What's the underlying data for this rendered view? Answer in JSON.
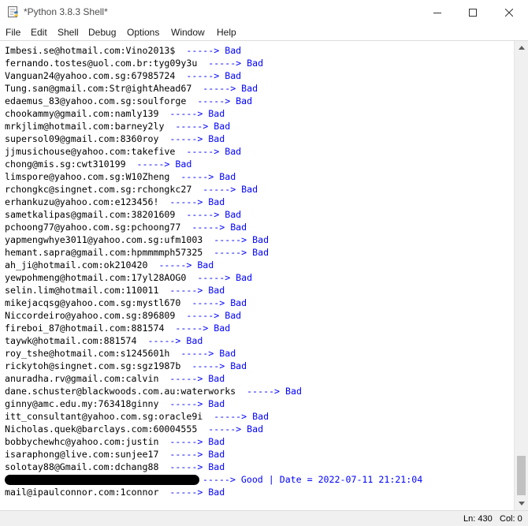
{
  "window": {
    "title": "*Python 3.8.3 Shell*",
    "icon": "python-idle-icon"
  },
  "menu": [
    "File",
    "Edit",
    "Shell",
    "Debug",
    "Options",
    "Window",
    "Help"
  ],
  "colors": {
    "stdout": "#0000ff",
    "text": "#000000",
    "background": "#ffffff"
  },
  "lines": [
    {
      "text": "Imbesi.se@hotmail.com:Vino2013$",
      "result": "-----> Bad"
    },
    {
      "text": "fernando.tostes@uol.com.br:tyg09y3u",
      "result": "-----> Bad"
    },
    {
      "text": "Vanguan24@yahoo.com.sg:67985724",
      "result": "-----> Bad"
    },
    {
      "text": "Tung.san@gmail.com:Str@ightAhead67",
      "result": "-----> Bad"
    },
    {
      "text": "edaemus_83@yahoo.com.sg:soulforge",
      "result": "-----> Bad"
    },
    {
      "text": "chookammy@gmail.com:namly139",
      "result": "-----> Bad"
    },
    {
      "text": "mrkjlim@hotmail.com:barney2ly",
      "result": "-----> Bad"
    },
    {
      "text": "supersol09@gmail.com:8360roy",
      "result": "-----> Bad"
    },
    {
      "text": "jjmusichouse@yahoo.com:takefive",
      "result": "-----> Bad"
    },
    {
      "text": "chong@mis.sg:cwt310199",
      "result": "-----> Bad"
    },
    {
      "text": "limspore@yahoo.com.sg:W10Zheng",
      "result": "-----> Bad"
    },
    {
      "text": "rchongkc@singnet.com.sg:rchongkc27",
      "result": "-----> Bad"
    },
    {
      "text": "erhankuzu@yahoo.com:e123456!",
      "result": "-----> Bad"
    },
    {
      "text": "sametkalipas@gmail.com:38201609",
      "result": "-----> Bad"
    },
    {
      "text": "pchoong77@yahoo.com.sg:pchoong77",
      "result": "-----> Bad"
    },
    {
      "text": "yapmengwhye3011@yahoo.com.sg:ufm1003",
      "result": "-----> Bad"
    },
    {
      "text": "hemant.sapra@gmail.com:hpmmmmph57325",
      "result": "-----> Bad"
    },
    {
      "text": "ah_ji@hotmail.com:ok210420",
      "result": "-----> Bad"
    },
    {
      "text": "yewpohmeng@hotmail.com:17yl28AOG0",
      "result": "-----> Bad"
    },
    {
      "text": "selin.lim@hotmail.com:110011",
      "result": "-----> Bad"
    },
    {
      "text": "mikejacqsg@yahoo.com.sg:mystl670",
      "result": "-----> Bad"
    },
    {
      "text": "Niccordeiro@yahoo.com.sg:896809",
      "result": "-----> Bad"
    },
    {
      "text": "fireboi_87@hotmail.com:881574",
      "result": "-----> Bad"
    },
    {
      "text": "taywk@hotmail.com:881574",
      "result": "-----> Bad"
    },
    {
      "text": "roy_tshe@hotmail.com:s1245601h",
      "result": "-----> Bad"
    },
    {
      "text": "rickytoh@singnet.com.sg:sgz1987b",
      "result": "-----> Bad"
    },
    {
      "text": "anuradha.rv@gmail.com:calvin",
      "result": "-----> Bad"
    },
    {
      "text": "dane.schuster@blackwoods.com.au:waterworks",
      "result": "-----> Bad"
    },
    {
      "text": "ginny@amc.edu.my:763418ginny",
      "result": "-----> Bad"
    },
    {
      "text": "itt_consultant@yahoo.com.sg:oracle9i",
      "result": "-----> Bad"
    },
    {
      "text": "Nicholas.quek@barclays.com:60004555",
      "result": "-----> Bad"
    },
    {
      "text": "bobbychewhc@yahoo.com:justin",
      "result": "-----> Bad"
    },
    {
      "text": "isaraphong@live.com:sunjee17",
      "result": "-----> Bad"
    },
    {
      "text": "solotay88@Gmail.com:dchang88",
      "result": "-----> Bad"
    },
    {
      "text": "",
      "redacted": true,
      "result": "-----> Good | Date = 2022-07-11 21:21:04"
    },
    {
      "text": "mail@ipaulconnor.com:1connor",
      "result": "-----> Bad"
    }
  ],
  "status": {
    "line": "Ln: 430",
    "col": "Col: 0"
  }
}
